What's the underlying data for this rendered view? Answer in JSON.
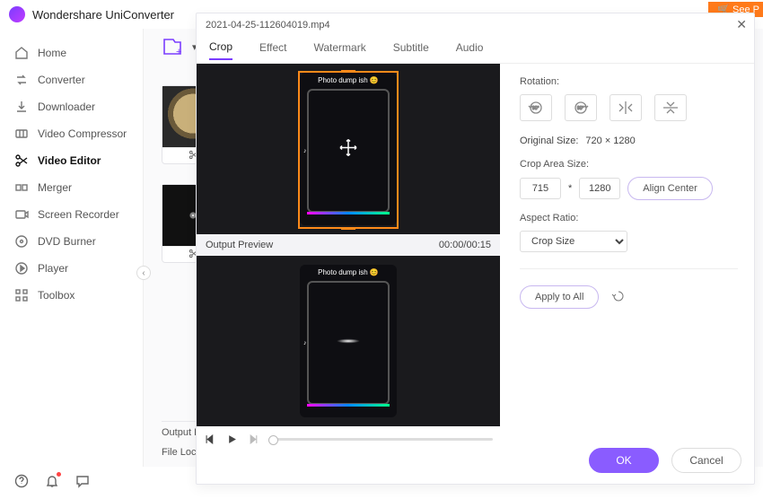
{
  "app": {
    "title": "Wondershare UniConverter",
    "ribbon": "See P"
  },
  "sidebar": {
    "items": [
      {
        "label": "Home"
      },
      {
        "label": "Converter"
      },
      {
        "label": "Downloader"
      },
      {
        "label": "Video Compressor"
      },
      {
        "label": "Video Editor"
      },
      {
        "label": "Merger"
      },
      {
        "label": "Screen Recorder"
      },
      {
        "label": "DVD Burner"
      },
      {
        "label": "Player"
      },
      {
        "label": "Toolbox"
      }
    ]
  },
  "main": {
    "output_label": "Output F",
    "file_label": "File Loca"
  },
  "modal": {
    "filename": "2021-04-25-112604019.mp4",
    "tabs": [
      "Crop",
      "Effect",
      "Watermark",
      "Subtitle",
      "Audio"
    ],
    "clip_caption": "Photo dump ish 😊",
    "output_preview_label": "Output Preview",
    "time": "00:00/00:15",
    "rotation_label": "Rotation:",
    "original_size_label": "Original Size:",
    "original_size_value": "720 × 1280",
    "crop_area_label": "Crop Area Size:",
    "crop_w": "715",
    "crop_sep": "*",
    "crop_h": "1280",
    "align_center": "Align Center",
    "aspect_ratio_label": "Aspect Ratio:",
    "aspect_ratio_value": "Crop Size",
    "apply_to_all": "Apply to All",
    "ok": "OK",
    "cancel": "Cancel"
  }
}
